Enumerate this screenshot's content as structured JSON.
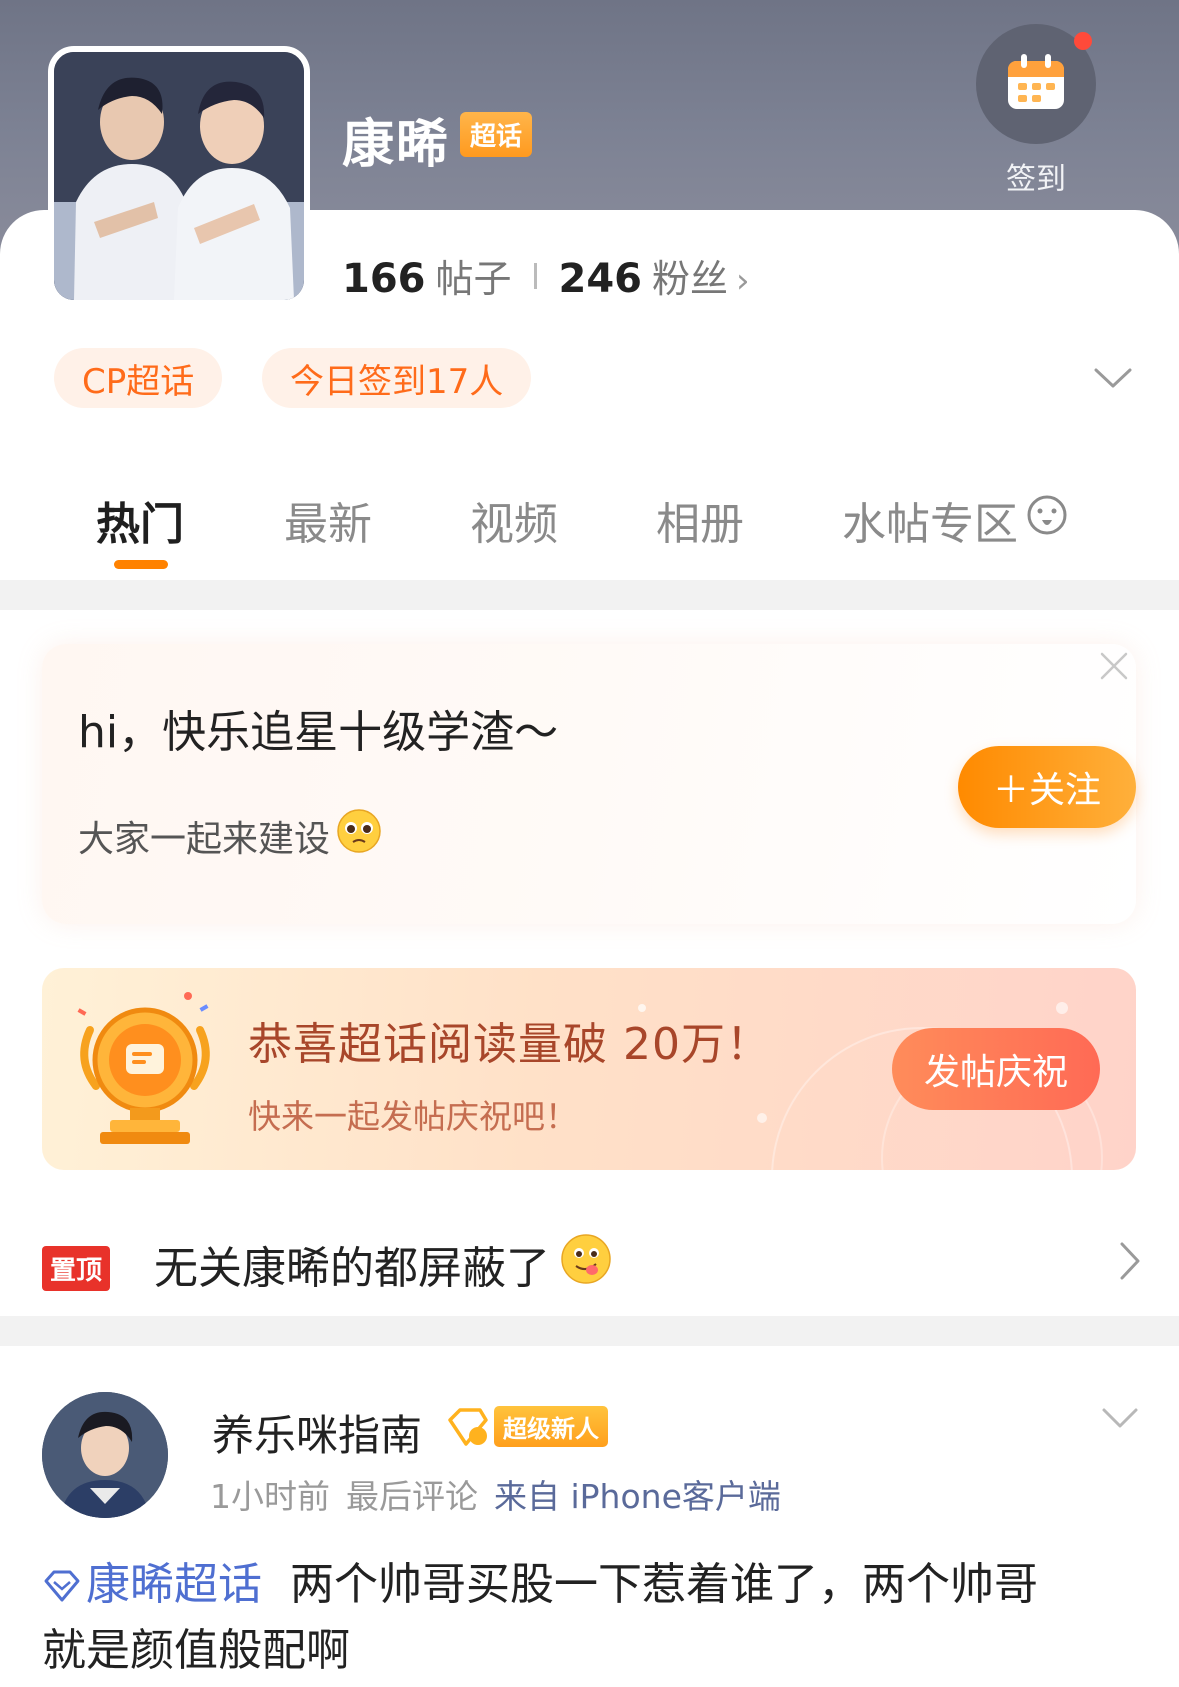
{
  "header": {
    "title": "康晞",
    "title_badge": "超话",
    "checkin_label": "签到",
    "posts_count": "166",
    "posts_label": "帖子",
    "fans_count": "246",
    "fans_label": "粉丝"
  },
  "chips": [
    "CP超话",
    "今日签到17人"
  ],
  "tabs": [
    {
      "label": "热门",
      "active": true
    },
    {
      "label": "最新",
      "active": false
    },
    {
      "label": "视频",
      "active": false
    },
    {
      "label": "相册",
      "active": false
    },
    {
      "label": "水帖专区",
      "active": false
    }
  ],
  "welcome": {
    "title": "hi，快乐追星十级学渣～",
    "subtitle": "大家一起来建设",
    "follow_label": "＋关注"
  },
  "banner": {
    "title": "恭喜超话阅读量破 20万！",
    "subtitle": "快来一起发帖庆祝吧！",
    "button_label": "发帖庆祝"
  },
  "pinned": {
    "tag": "置顶",
    "text": "无关康晞的都屏蔽了"
  },
  "post": {
    "author": "养乐咪指南",
    "level_badge": "超级新人",
    "time": "1小时前",
    "last_comment": "最后评论",
    "source": "来自 iPhone客户端",
    "topic": "康晞超话",
    "text_line1": "两个帅哥买股一下惹着谁了，两个帅哥",
    "text_line2": "就是颜值般配啊"
  },
  "colors": {
    "accent": "#ff8200",
    "header_bg": "#7d8294",
    "link": "#4f6fd1",
    "pin_red": "#e8322a"
  },
  "icons": [
    "calendar-icon",
    "chevron-right-icon",
    "chevron-down-icon",
    "close-icon",
    "trophy-icon",
    "diamond-icon",
    "emoji-icon"
  ]
}
